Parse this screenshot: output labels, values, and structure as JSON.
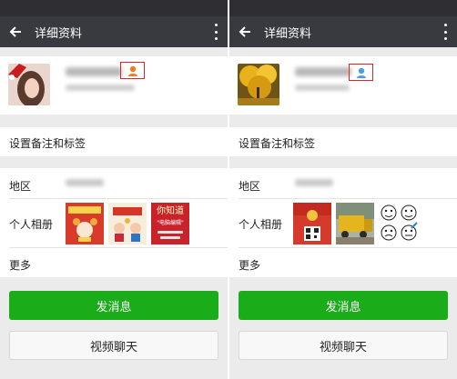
{
  "screens": [
    {
      "header": {
        "title": "详细资料"
      },
      "gender": "female",
      "remark_label": "设置备注和标签",
      "region_label": "地区",
      "album_label": "个人相册",
      "more_label": "更多",
      "send_button": "发消息",
      "video_button": "视频聊天",
      "thumbs": [
        "thumb-new-year-poster",
        "thumb-greeting-card",
        "thumb-red-text-poster"
      ],
      "thumb_texts": {
        "third_big": "你知道",
        "third_small": "\"电脑编辑\""
      }
    },
    {
      "header": {
        "title": "详细资料"
      },
      "gender": "male",
      "remark_label": "设置备注和标签",
      "region_label": "地区",
      "album_label": "个人相册",
      "more_label": "更多",
      "send_button": "发消息",
      "video_button": "视频聊天",
      "thumbs": [
        "thumb-red-envelope",
        "thumb-truck-photo",
        "thumb-meme-faces"
      ]
    }
  ],
  "colors": {
    "appbar": "#393a3f",
    "statusbar": "#2e2e33",
    "primary_green": "#1aad19",
    "highlight_red": "#d9272e",
    "female_icon": "#f07c24",
    "male_icon": "#4c9ee5"
  }
}
